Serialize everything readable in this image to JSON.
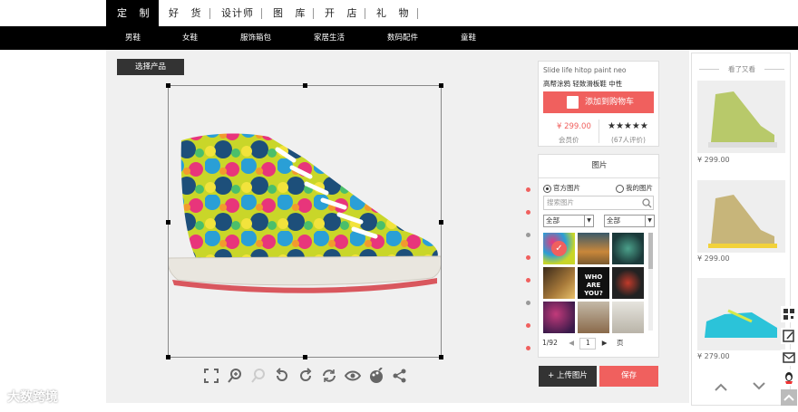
{
  "topnav": {
    "items": [
      "定 制",
      "好 货",
      "设计师",
      "图 库",
      "开 店",
      "礼 物"
    ]
  },
  "subnav": {
    "items": [
      "男鞋",
      "女鞋",
      "服饰箱包",
      "家居生活",
      "数码配件",
      "童鞋"
    ]
  },
  "editor": {
    "select_product_label": "选择产品",
    "toolbar_icons": [
      "fullscreen-icon",
      "zoom-in-icon",
      "zoom-out-icon",
      "rotate-left-icon",
      "rotate-right-icon",
      "refresh-icon",
      "preview-icon",
      "color-icon",
      "share-icon"
    ]
  },
  "product": {
    "title": "Slide life hitop paint neo",
    "subtitle": "高帮涂鸦 轻致滑板鞋 中性",
    "add_to_cart": "添加到购物车",
    "price": "¥ 299.00",
    "price_label": "会员价",
    "rating": "★★★★★",
    "reviews": "(67人评价)"
  },
  "images": {
    "tab": "图片",
    "official": "官方图片",
    "mine": "我的图片",
    "search_placeholder": "搜索图片",
    "filter1": "全部",
    "filter2": "全部",
    "page_total": "1/92",
    "page_current": "1",
    "page_suffix": "页"
  },
  "actions": {
    "upload": "+ 上传图片",
    "save": "保存"
  },
  "recent": {
    "title": "看了又看",
    "prices": [
      "¥ 299.00",
      "¥ 299.00",
      "¥ 279.00"
    ]
  },
  "watermark": "大数跨境",
  "colors": {
    "accent": "#f0605e",
    "dark": "#333333"
  }
}
